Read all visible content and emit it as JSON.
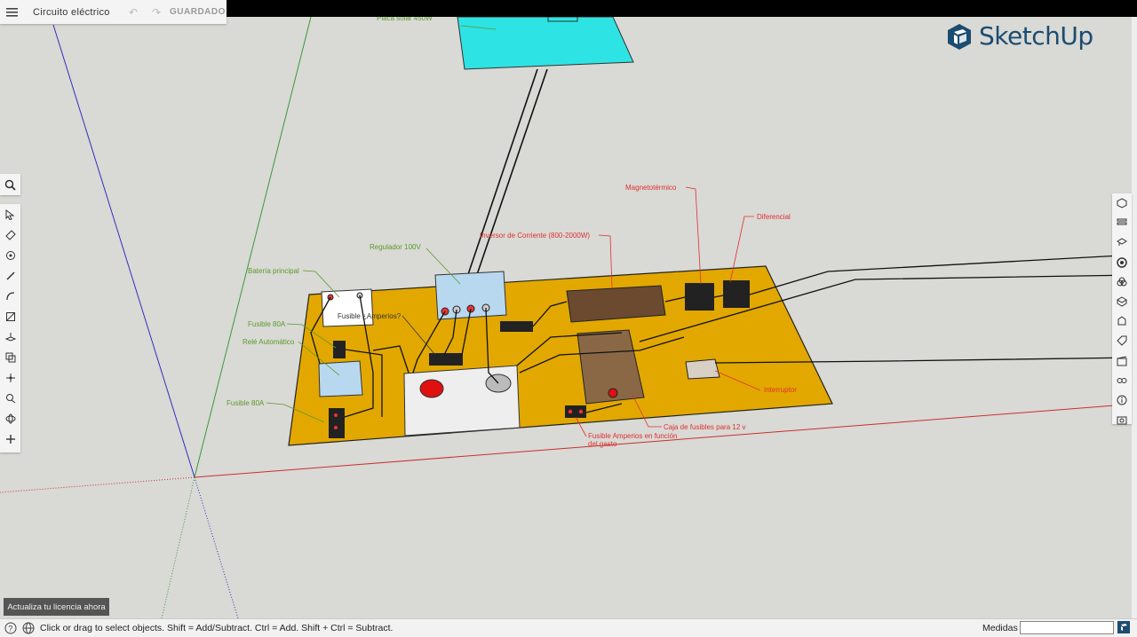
{
  "file_panel": {
    "title": "Circuito eléctrico",
    "saved_label": "GUARDADO",
    "undo_icon": "undo-icon",
    "redo_icon": "redo-icon"
  },
  "brand": {
    "name": "SketchUp",
    "color": "#1b4c71"
  },
  "license_button": "Actualiza tu licencia ahora",
  "status": {
    "hint": "Click or drag to select objects. Shift = Add/Subtract. Ctrl = Add. Shift + Ctrl = Subtract.",
    "measure_label": "Medidas",
    "measure_value": ""
  },
  "left_tools": [
    "select-icon",
    "eraser-icon",
    "paint-icon",
    "pencil-icon",
    "arc-icon",
    "rectangle-icon",
    "push-pull-icon",
    "offset-icon",
    "move-icon",
    "tape-measure-icon",
    "orbit-icon",
    "pan-icon"
  ],
  "right_tools": [
    "entity-info-icon",
    "layers-icon",
    "instructor-icon",
    "materials-icon",
    "components-icon",
    "styles-icon",
    "outliner-icon",
    "tags-icon",
    "scenes-icon",
    "display-icon",
    "info-icon",
    "camera-icon"
  ],
  "labels": {
    "solar": "Placa solar 450W",
    "magnetotermico": "Magnetotérmico",
    "diferencial": "Diferencial",
    "inversor": "Inversor de Corriente (800-2000W)",
    "regulador": "Regulador 100V",
    "bateria": "Batería principal",
    "fusible_q": "Fusible ¿Amperios?",
    "fusible80a_1": "Fusible 80A",
    "rele": "Relé Automático",
    "fusible80a_2": "Fusible 80A",
    "interruptor": "Interruptor",
    "caja_fusibles": "Caja de fusibles para 12 v",
    "fusible_gasto_1": "Fusible Amperios en función",
    "fusible_gasto_2": "del gasto"
  },
  "colors": {
    "board": "#e2a800",
    "solar_panel": "#2ee3e3",
    "inverter": "#6b4a30",
    "battery": "#cfe3f5",
    "axis_red": "#c73030",
    "axis_green": "#3a9a3a",
    "axis_blue": "#3030c0"
  }
}
